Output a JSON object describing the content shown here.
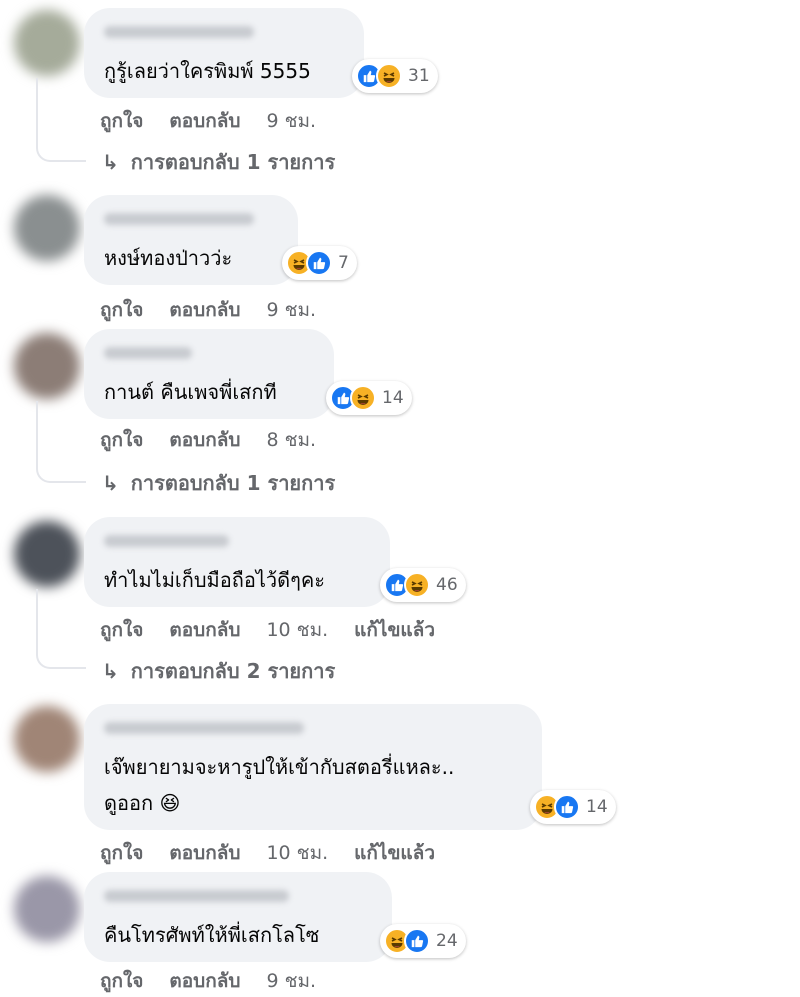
{
  "colors": {
    "like": "#1877f2",
    "haha": "#f7b125",
    "bubble": "#f0f2f5",
    "meta": "#65676b"
  },
  "labels": {
    "like": "ถูกใจ",
    "reply": "ตอบกลับ",
    "edited": "แก้ไขแล้ว"
  },
  "comments": [
    {
      "text": "กูรู้เลยว่าใครพิมพ์ 5555",
      "reactions": [
        "like-icon",
        "haha-icon"
      ],
      "reaction_count": "31",
      "time": "9 ชม.",
      "edited": false,
      "replies_label": "การตอบกลับ 1 รายการ"
    },
    {
      "text": "หงษ์ทองป่าวว่ะ",
      "reactions": [
        "haha-icon",
        "like-icon"
      ],
      "reaction_count": "7",
      "time": "9 ชม.",
      "edited": false,
      "replies_label": ""
    },
    {
      "text": "กานต์ คืนเพจพี่เสกที",
      "reactions": [
        "like-icon",
        "haha-icon"
      ],
      "reaction_count": "14",
      "time": "8 ชม.",
      "edited": false,
      "replies_label": "การตอบกลับ 1 รายการ"
    },
    {
      "text": "ทำไมไม่เก็บมือถือไว้ดีๆคะ",
      "reactions": [
        "like-icon",
        "haha-icon"
      ],
      "reaction_count": "46",
      "time": "10 ชม.",
      "edited": true,
      "replies_label": "การตอบกลับ 2 รายการ"
    },
    {
      "text": "เจ๊พยายามจะหารูปให้เข้ากับสตอรี่แหละ..",
      "text_line2": "ดูออก 😆",
      "reactions": [
        "haha-icon",
        "like-icon"
      ],
      "reaction_count": "14",
      "time": "10 ชม.",
      "edited": true,
      "replies_label": ""
    },
    {
      "text": "คืนโทรศัพท์ให้พี่เสกโลโซ",
      "reactions": [
        "haha-icon",
        "like-icon"
      ],
      "reaction_count": "24",
      "time": "9 ชม.",
      "edited": false,
      "replies_label": ""
    }
  ]
}
